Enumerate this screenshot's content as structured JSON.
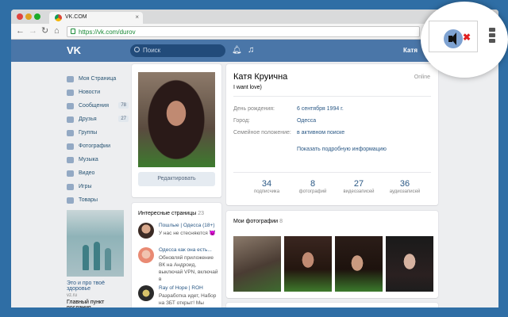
{
  "browser": {
    "tab_title": "VK.COM",
    "tab_close": "×",
    "url": "https://vk.com/durov"
  },
  "header": {
    "search_placeholder": "Поиск",
    "user_name": "Катя"
  },
  "leftnav": [
    {
      "label": "Моя Страница",
      "count": ""
    },
    {
      "label": "Новости",
      "count": ""
    },
    {
      "label": "Сообщения",
      "count": "78"
    },
    {
      "label": "Друзья",
      "count": "27"
    },
    {
      "label": "Группы",
      "count": ""
    },
    {
      "label": "Фотографии",
      "count": ""
    },
    {
      "label": "Музыка",
      "count": ""
    },
    {
      "label": "Видео",
      "count": ""
    },
    {
      "label": "Игры",
      "count": ""
    },
    {
      "label": "Товары",
      "count": ""
    }
  ],
  "ad": {
    "title": "Это и про твоё здоровье",
    "domain": "vz.ru",
    "text": "Главный пункт послания"
  },
  "avatar": {
    "edit_label": "Редактировать"
  },
  "profile": {
    "name": "Катя Круична",
    "status": "I want love)",
    "online": "Online",
    "info": [
      {
        "label": "День рождения:",
        "value": "6 сентября 1994 г."
      },
      {
        "label": "Город:",
        "value": "Одесса"
      },
      {
        "label": "Семейное положение:",
        "value": "в активном поиске"
      }
    ],
    "more_link": "Показать подробную информацию",
    "stats": [
      {
        "num": "34",
        "label": "подписчика"
      },
      {
        "num": "8",
        "label": "фотографий"
      },
      {
        "num": "27",
        "label": "видеозаписей"
      },
      {
        "num": "36",
        "label": "аудиозаписей"
      }
    ]
  },
  "interests": {
    "title": "Интересные страницы",
    "count": "23",
    "items": [
      {
        "name": "Пошлые | Одесса (18+)",
        "desc": "У нас не стесняются 😈"
      },
      {
        "name": "Одесса как она есть...",
        "desc": "Обновляй приложение ВК на Андроид, выключай VPN, включай в"
      },
      {
        "name": "Ray of Hope | ROH",
        "desc": "Разработка идет, Набор на ЗБТ открыт! Мы"
      }
    ]
  },
  "photos": {
    "title": "Мои фотографии",
    "count": "8"
  },
  "colors": {
    "vk_blue": "#4a76a8",
    "link": "#2a5885",
    "mute_red": "#e02020"
  },
  "icons": {
    "extension": "mute-speaker-icon",
    "mute": "✖"
  }
}
